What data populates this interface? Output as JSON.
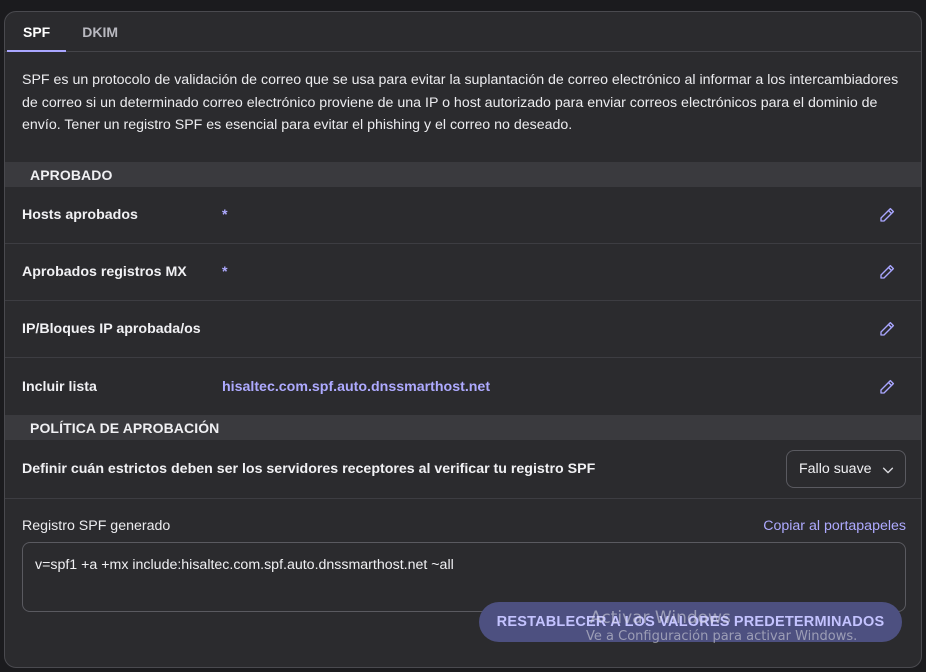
{
  "tabs": [
    {
      "label": "SPF",
      "active": true
    },
    {
      "label": "DKIM",
      "active": false
    }
  ],
  "intro": "SPF es un protocolo de validación de correo que se usa para evitar la suplantación de correo electrónico al informar a los intercambiadores de correo si un determinado correo electrónico proviene de una IP o host autorizado para enviar correos electrónicos para el dominio de envío. Tener un registro SPF es esencial para evitar el phishing y el correo no deseado.",
  "approved": {
    "header": "APROBADO",
    "rows": [
      {
        "label": "Hosts aprobados",
        "value": "*"
      },
      {
        "label": "Aprobados registros MX",
        "value": "*"
      },
      {
        "label": "IP/Bloques IP aprobada/os",
        "value": ""
      },
      {
        "label": "Incluir lista",
        "value": "hisaltec.com.spf.auto.dnssmarthost.net"
      }
    ],
    "edit_icon": "pencil-icon"
  },
  "policy": {
    "header": "POLÍTICA DE APROBACIÓN",
    "label": "Definir cuán estrictos deben ser los servidores receptores al verificar tu registro SPF",
    "selected": "Fallo suave",
    "chevron_icon": "chevron-down-icon"
  },
  "generated": {
    "label": "Registro SPF generado",
    "copy_label": "Copiar al portapapeles",
    "record": "v=spf1 +a +mx include:hisaltec.com.spf.auto.dnssmarthost.net ~all"
  },
  "reset_label": "RESTABLECER A LOS VALORES PREDETERMINADOS",
  "watermark": {
    "title": "Activar Windows",
    "subtitle": "Ve a Configuración para activar Windows."
  },
  "colors": {
    "accent": "#aeaaff",
    "panel": "#2b2b2e",
    "section": "#3a3a3e",
    "button": "#4d5080"
  }
}
